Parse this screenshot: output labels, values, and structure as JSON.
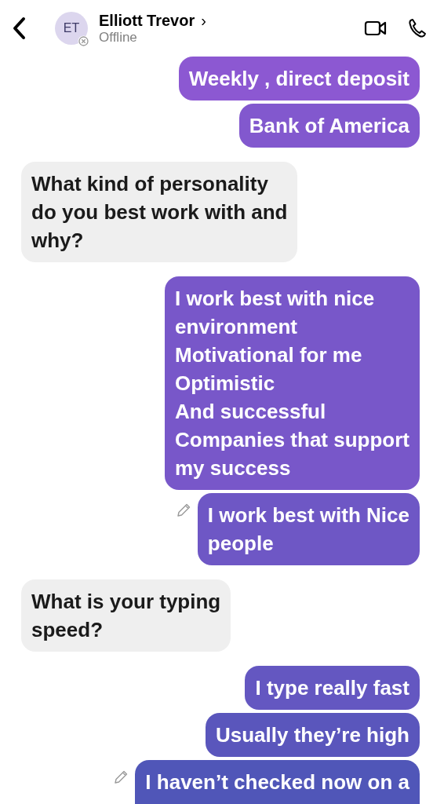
{
  "header": {
    "avatar_initials": "ET",
    "contact_name": "Elliott Trevor",
    "chevron": "›",
    "status": "Offline",
    "offline": true
  },
  "messages": [
    {
      "kind": "outgoing",
      "text": "Weekly , direct deposit",
      "edited": false
    },
    {
      "kind": "outgoing",
      "text": "Bank of America",
      "edited": false
    },
    {
      "kind": "incoming",
      "text": "What kind of personality\ndo you best work with and\nwhy?",
      "edited": false
    },
    {
      "kind": "outgoing",
      "text": "I work best with nice\nenvironment\nMotivational for me\nOptimistic\nAnd successful\nCompanies that support\nmy success",
      "edited": false
    },
    {
      "kind": "outgoing",
      "text": "I work best with Nice\npeople",
      "edited": true
    },
    {
      "kind": "incoming",
      "text": "What is your typing\nspeed?",
      "edited": false
    },
    {
      "kind": "outgoing",
      "text": "I type really fast",
      "edited": false
    },
    {
      "kind": "outgoing",
      "text": "Usually they’re high",
      "edited": false
    },
    {
      "kind": "outgoing",
      "text": "I haven’t checked now on a",
      "edited": true
    }
  ]
}
